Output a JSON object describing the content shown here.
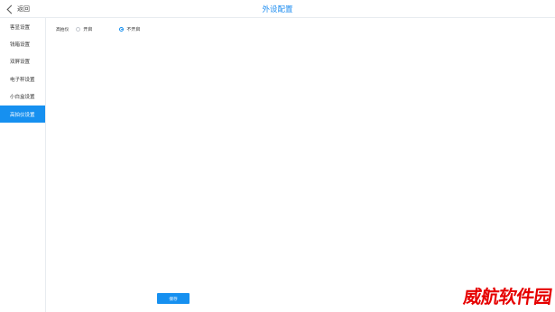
{
  "header": {
    "back_label": "返回",
    "title": "外设配置"
  },
  "sidebar": {
    "items": [
      {
        "label": "客显设置",
        "active": false
      },
      {
        "label": "钱箱设置",
        "active": false
      },
      {
        "label": "双屏设置",
        "active": false
      },
      {
        "label": "电子秤设置",
        "active": false
      },
      {
        "label": "小白盒设置",
        "active": false
      },
      {
        "label": "高拍仪设置",
        "active": true
      }
    ]
  },
  "settings": {
    "label": "高拍仪",
    "options": [
      {
        "label": "开启",
        "checked": false
      },
      {
        "label": "不开启",
        "checked": true
      }
    ]
  },
  "footer": {
    "save_label": "保存"
  },
  "watermark": "威航软件园",
  "colors": {
    "accent": "#1690f0",
    "title": "#1c8cf0",
    "watermark": "#e60000"
  }
}
